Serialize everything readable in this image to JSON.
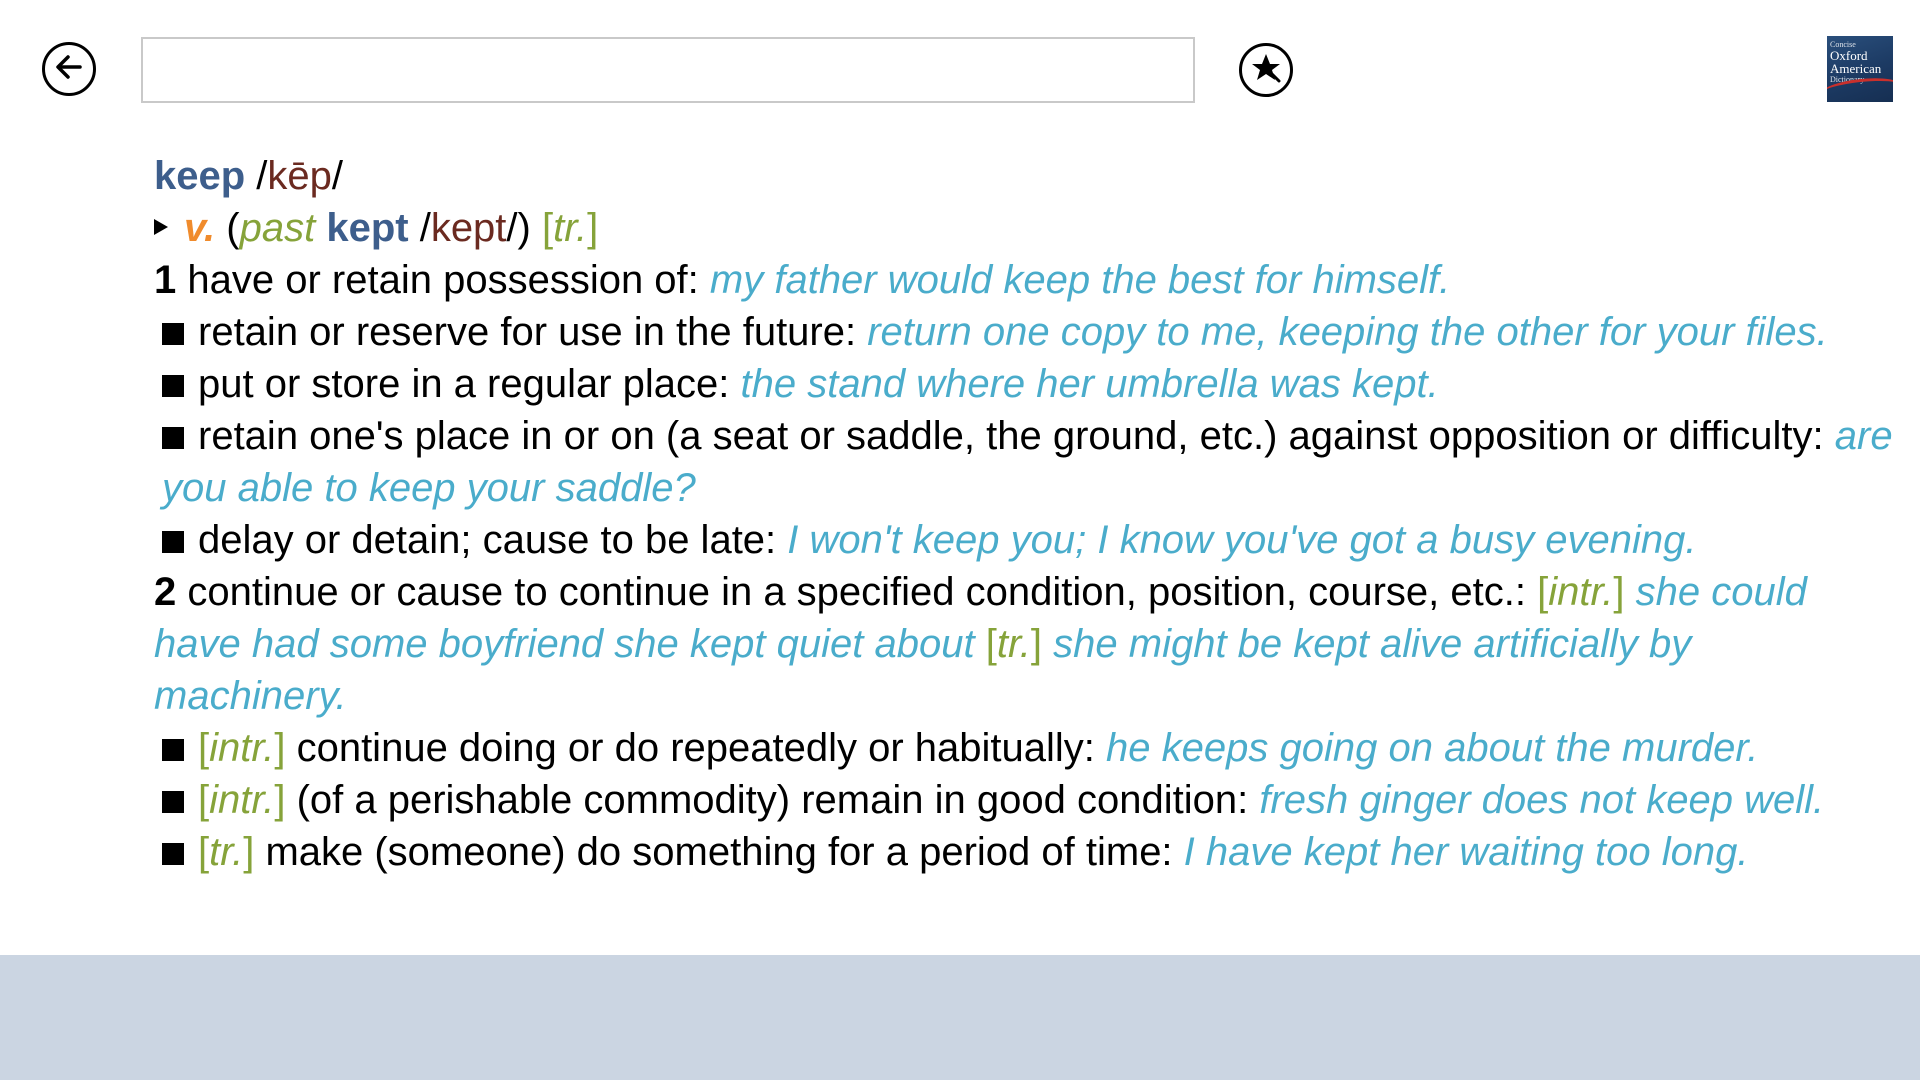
{
  "toolbar": {
    "search_value": "",
    "back_icon": "back-arrow-icon",
    "favorite_icon": "star-icon"
  },
  "logo": {
    "line1": "Concise",
    "line2": "Oxford",
    "line3": "American",
    "line4": "Dictionary"
  },
  "entry": {
    "headword": "keep",
    "pron": "kēp",
    "pos": "v.",
    "past_label": "past",
    "past_form": "kept",
    "past_pron": "kept",
    "tr_label": "tr.",
    "sense1": {
      "num": "1",
      "def": "have or retain possession of:",
      "ex": "my father would keep the best for himself."
    },
    "sub1a": {
      "def": "retain or reserve for use in the future:",
      "ex": "return one copy to me, keeping the other for your files."
    },
    "sub1b": {
      "def": "put or store in a regular place:",
      "ex": "the stand where her umbrella was kept."
    },
    "sub1c": {
      "def": "retain one's place in or on (a seat or saddle, the ground, etc.) against opposition or difficulty:",
      "ex": "are you able to keep your saddle?"
    },
    "sub1d": {
      "def": "delay or detain; cause to be late:",
      "ex": "I won't keep you; I know you've got a busy evening."
    },
    "sense2": {
      "num": "2",
      "def": "continue or cause to continue in a specified condition, position, course, etc.:",
      "label1": "intr.",
      "ex1": "she could have had some boyfriend she kept quiet about",
      "label2": "tr.",
      "ex2": "she might be kept alive artificially by machinery."
    },
    "sub2a": {
      "label": "intr.",
      "def": "continue doing or do repeatedly or habitually:",
      "ex": "he keeps going on about the murder."
    },
    "sub2b": {
      "label": "intr.",
      "def": "(of a perishable commodity) remain in good condition:",
      "ex": "fresh ginger does not keep well."
    },
    "sub2c": {
      "label": "tr.",
      "def": "make (someone) do something for a period of time:",
      "ex": "I have kept her waiting too long."
    }
  }
}
